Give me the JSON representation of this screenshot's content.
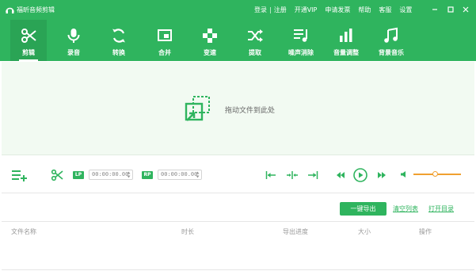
{
  "app": {
    "title": "福昕音频剪辑"
  },
  "titlebar": {
    "links": {
      "login": "登录",
      "separator": "|",
      "register": "注册",
      "vip": "开通VIP",
      "invoice": "申请发票",
      "help": "帮助",
      "service": "客服",
      "settings": "设置"
    }
  },
  "toolbar": {
    "tools": [
      {
        "label": "剪辑",
        "icon": "scissors-icon",
        "active": true
      },
      {
        "label": "录音",
        "icon": "microphone-icon",
        "active": false
      },
      {
        "label": "转换",
        "icon": "convert-icon",
        "active": false
      },
      {
        "label": "合并",
        "icon": "merge-icon",
        "active": false
      },
      {
        "label": "变速",
        "icon": "speed-icon",
        "active": false
      },
      {
        "label": "提取",
        "icon": "extract-icon",
        "active": false
      },
      {
        "label": "噪声消除",
        "icon": "noise-removal-icon",
        "active": false
      },
      {
        "label": "音量调整",
        "icon": "volume-adjust-icon",
        "active": false
      },
      {
        "label": "背景音乐",
        "icon": "music-note-icon",
        "active": false
      }
    ]
  },
  "dropzone": {
    "text": "拖动文件到此处"
  },
  "editor": {
    "lp_label": "LP",
    "rp_label": "RP",
    "start_time": "00:00:00.00",
    "end_time": "00:00:00.00",
    "volume_level": 0.45
  },
  "actions": {
    "export_label": "一键导出",
    "clear_label": "清空列表",
    "open_dir_label": "打开目录"
  },
  "table": {
    "columns": [
      "文件名称",
      "时长",
      "导出进度",
      "大小",
      "操作"
    ]
  },
  "colors": {
    "accent": "#2fb45e",
    "active_tab": "#2aa455",
    "dropzone_bg": "#f2faf2",
    "volume": "#f0a030"
  }
}
